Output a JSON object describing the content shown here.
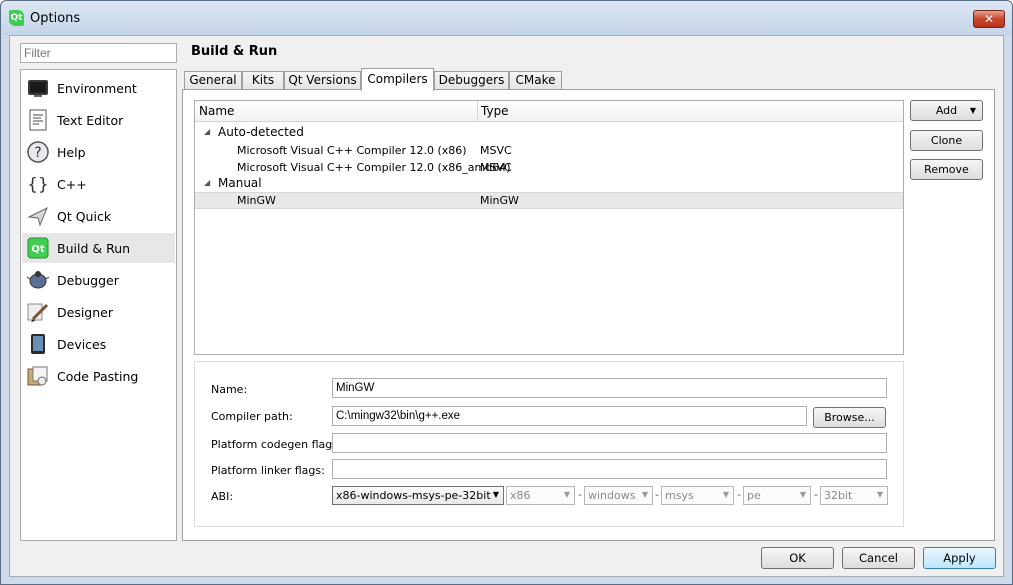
{
  "window": {
    "title": "Options"
  },
  "filter": {
    "placeholder": "Filter",
    "value": ""
  },
  "sidebar": {
    "items": [
      {
        "label": "Environment",
        "icon": "environment-icon",
        "selected": false
      },
      {
        "label": "Text Editor",
        "icon": "text-editor-icon",
        "selected": false
      },
      {
        "label": "Help",
        "icon": "help-icon",
        "selected": false
      },
      {
        "label": "C++",
        "icon": "cpp-icon",
        "selected": false
      },
      {
        "label": "Qt Quick",
        "icon": "qt-quick-icon",
        "selected": false
      },
      {
        "label": "Build & Run",
        "icon": "build-run-icon",
        "selected": true
      },
      {
        "label": "Debugger",
        "icon": "debugger-icon",
        "selected": false
      },
      {
        "label": "Designer",
        "icon": "designer-icon",
        "selected": false
      },
      {
        "label": "Devices",
        "icon": "devices-icon",
        "selected": false
      },
      {
        "label": "Code Pasting",
        "icon": "code-pasting-icon",
        "selected": false
      }
    ]
  },
  "page": {
    "title": "Build & Run"
  },
  "tabs": [
    {
      "label": "General",
      "active": false
    },
    {
      "label": "Kits",
      "active": false
    },
    {
      "label": "Qt Versions",
      "active": false
    },
    {
      "label": "Compilers",
      "active": true
    },
    {
      "label": "Debuggers",
      "active": false
    },
    {
      "label": "CMake",
      "active": false
    }
  ],
  "compilers": {
    "columns": {
      "name": "Name",
      "type": "Type"
    },
    "groups": [
      {
        "label": "Auto-detected",
        "items": [
          {
            "name": "Microsoft Visual C++ Compiler 12.0 (x86)",
            "type": "MSVC"
          },
          {
            "name": "Microsoft Visual C++ Compiler 12.0 (x86_amd64)",
            "type": "MSVC"
          }
        ]
      },
      {
        "label": "Manual",
        "items": [
          {
            "name": "MinGW",
            "type": "MinGW",
            "selected": true
          }
        ]
      }
    ],
    "buttons": {
      "add": "Add",
      "clone": "Clone",
      "remove": "Remove"
    }
  },
  "details": {
    "name_label": "Name:",
    "name_value": "MinGW",
    "path_label": "Compiler path:",
    "path_value": "C:\\mingw32\\bin\\g++.exe",
    "browse_label": "Browse...",
    "codegen_label": "Platform codegen flags:",
    "codegen_value": "",
    "linker_label": "Platform linker flags:",
    "linker_value": "",
    "abi_label": "ABI:",
    "abi_main": "x86-windows-msys-pe-32bit",
    "abi_parts": [
      "x86",
      "windows",
      "msys",
      "pe",
      "32bit"
    ],
    "abi_separator": "-"
  },
  "footer": {
    "ok": "OK",
    "cancel": "Cancel",
    "apply": "Apply"
  },
  "colors": {
    "qt_green": "#41cd52",
    "window_frame": "#cfdbe9",
    "close_red": "#c9452d"
  }
}
